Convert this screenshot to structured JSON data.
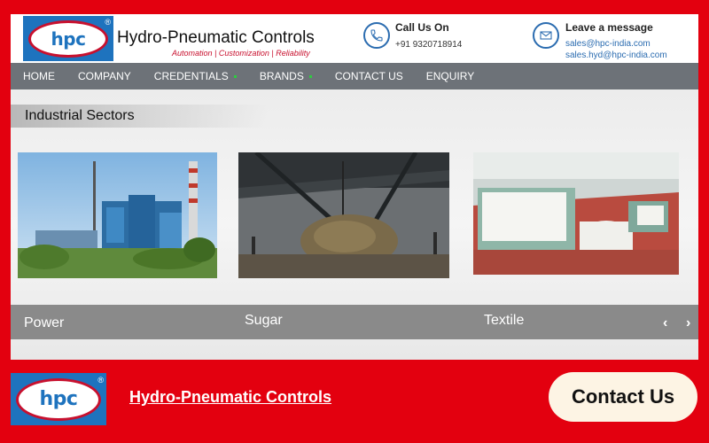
{
  "header": {
    "logo_text": "hpc",
    "logo_reg": "®",
    "company_name": "Hydro-Pneumatic Controls",
    "tagline": "Automation | Customization | Reliability",
    "call": {
      "title": "Call Us On",
      "phone": "+91 9320718914",
      "icon": "phone-icon"
    },
    "message": {
      "title": "Leave a message",
      "emails": [
        "sales@hpc-india.com",
        "sales.hyd@hpc-india.com"
      ],
      "icon": "mail-icon"
    }
  },
  "nav": {
    "items": [
      {
        "label": "HOME"
      },
      {
        "label": "COMPANY"
      },
      {
        "label": "CREDENTIALS",
        "has_dropdown": true
      },
      {
        "label": "BRANDS",
        "has_dropdown": true
      },
      {
        "label": "CONTACT US"
      },
      {
        "label": "ENQUIRY"
      }
    ]
  },
  "sectors": {
    "title": "Industrial  Sectors",
    "items": [
      {
        "caption": "Power"
      },
      {
        "caption": "Sugar"
      },
      {
        "caption": "Textile"
      }
    ],
    "prev_arrow": "‹",
    "next_arrow": "›"
  },
  "footer": {
    "logo_text": "hpc",
    "logo_reg": "®",
    "link_text": "Hydro-Pneumatic Controls",
    "contact_label": "Contact Us"
  },
  "colors": {
    "background": "#e3000f",
    "brand_blue": "#1e73be",
    "brand_red": "#c8102e",
    "nav_gray": "#6d7278",
    "caption_gray": "#8a8a8a",
    "button_cream": "#fdf4e4"
  }
}
